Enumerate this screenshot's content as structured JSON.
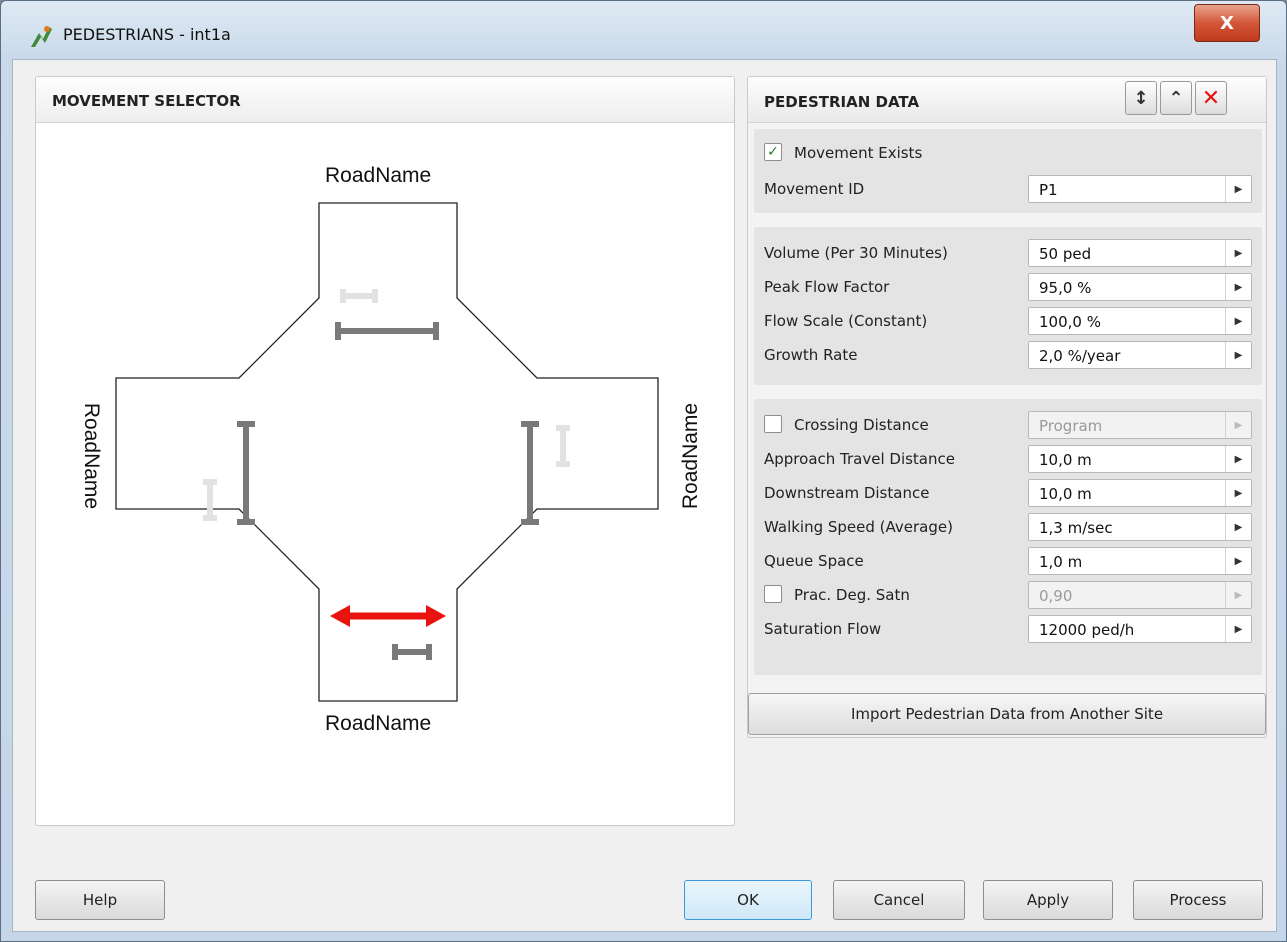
{
  "window": {
    "title": "PEDESTRIANS - int1a",
    "close_label": "X"
  },
  "movement_selector": {
    "title": "MOVEMENT SELECTOR",
    "road_labels": {
      "north": "RoadName",
      "south": "RoadName",
      "west": "RoadName",
      "east": "RoadName"
    }
  },
  "pedestrian_data": {
    "title": "PEDESTRIAN DATA",
    "header_icons": [
      "expand-vertical-icon",
      "collapse-vertical-icon",
      "delete-icon"
    ],
    "movement_exists": {
      "label": "Movement Exists",
      "checked": true
    },
    "movement_id": {
      "label": "Movement ID",
      "value": "P1"
    },
    "volume": {
      "label": "Volume (Per 30 Minutes)",
      "value": "50 ped"
    },
    "peak_flow_factor": {
      "label": "Peak Flow Factor",
      "value": "95,0 %"
    },
    "flow_scale": {
      "label": "Flow Scale (Constant)",
      "value": "100,0 %"
    },
    "growth_rate": {
      "label": "Growth Rate",
      "value": "2,0 %/year"
    },
    "crossing_distance": {
      "label": "Crossing Distance",
      "value": "Program",
      "checked": false
    },
    "approach_travel_distance": {
      "label": "Approach Travel Distance",
      "value": "10,0 m"
    },
    "downstream_distance": {
      "label": "Downstream Distance",
      "value": "10,0 m"
    },
    "walking_speed": {
      "label": "Walking Speed (Average)",
      "value": "1,3 m/sec"
    },
    "queue_space": {
      "label": "Queue Space",
      "value": "1,0 m"
    },
    "prac_deg_satn": {
      "label": "Prac. Deg. Satn",
      "value": "0,90",
      "checked": false
    },
    "saturation_flow": {
      "label": "Saturation Flow",
      "value": "12000 ped/h"
    },
    "import_button": "Import Pedestrian Data from Another Site"
  },
  "footer": {
    "help": "Help",
    "ok": "OK",
    "cancel": "Cancel",
    "apply": "Apply",
    "process": "Process"
  },
  "colors": {
    "selected_movement": "#e8120f",
    "crossing_marker": "#7a7a7a",
    "crossing_marker_faint": "#dddddd"
  }
}
